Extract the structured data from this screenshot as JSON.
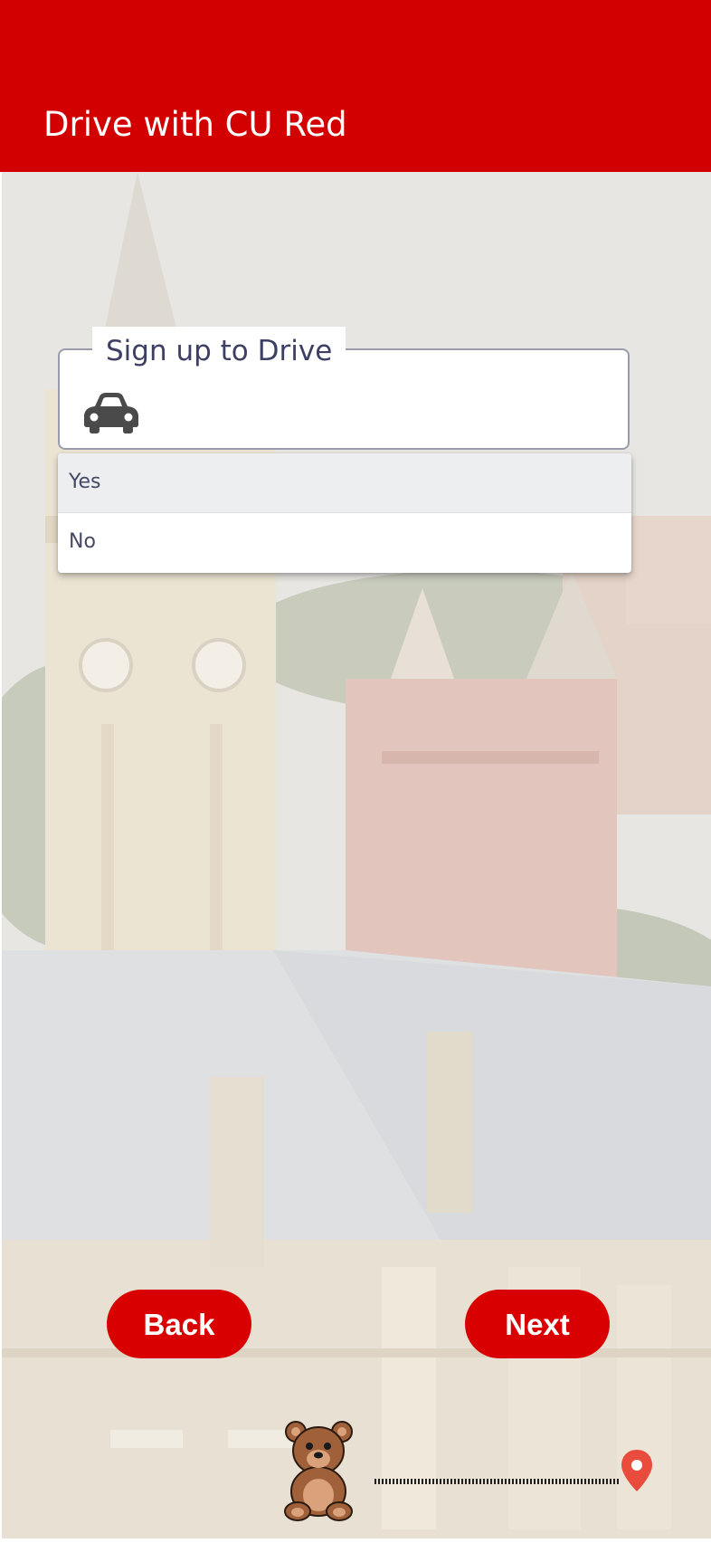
{
  "header": {
    "title": "Drive with CU Red"
  },
  "signup_field": {
    "label": "Sign up to Drive",
    "icon": "car-icon",
    "options": [
      "Yes",
      "No"
    ],
    "highlighted_option": "Yes"
  },
  "navigation": {
    "back_label": "Back",
    "next_label": "Next"
  },
  "progress": {
    "start_icon": "bear-icon",
    "end_icon": "location-pin-icon"
  },
  "colors": {
    "brand_red": "#d30000",
    "button_red": "#d80000",
    "pin_red": "#e94b3c",
    "field_border": "#9a9cae"
  }
}
